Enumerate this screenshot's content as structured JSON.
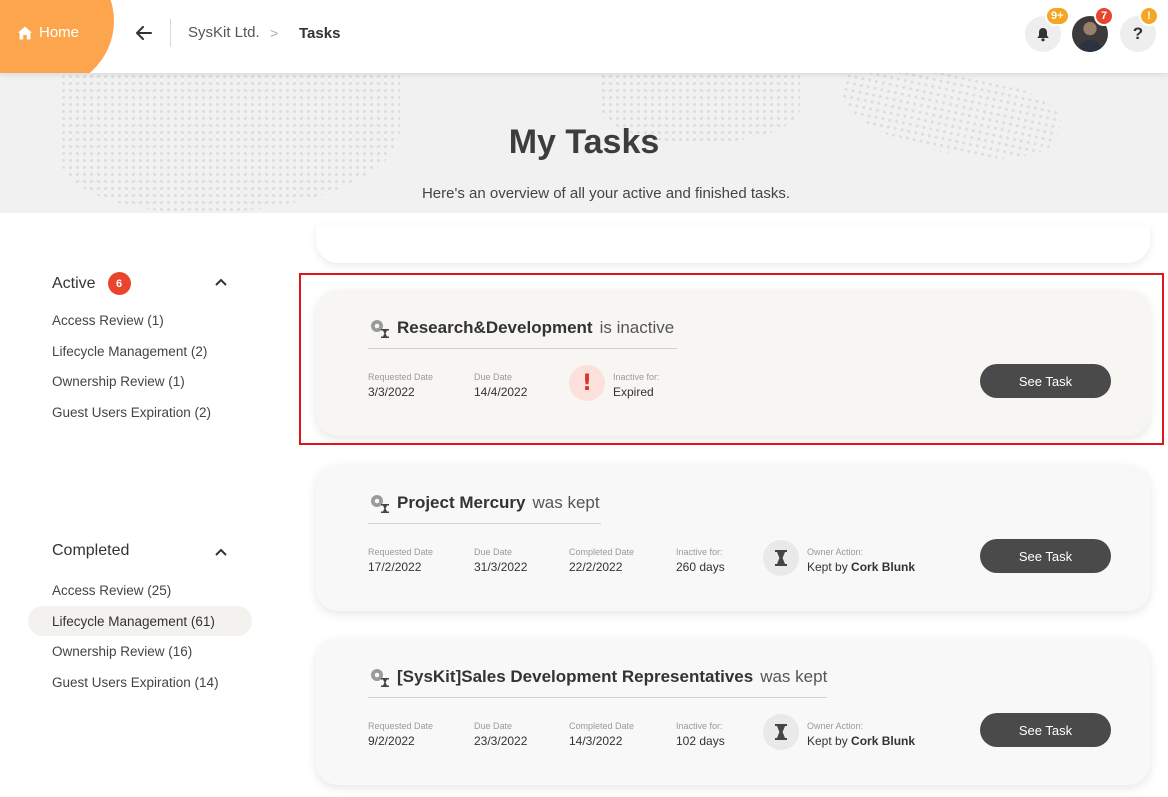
{
  "topbar": {
    "home_label": "Home",
    "breadcrumb": {
      "org": "SysKit Ltd.",
      "separator": ">",
      "current": "Tasks"
    },
    "notifications_badge": "9+",
    "profile_badge": "7",
    "help_badge": "!",
    "help_label": "?",
    "colors": {
      "accent": "#fca54d",
      "badge_orange": "#f5a623",
      "badge_red": "#e8452c"
    }
  },
  "hero": {
    "title": "My Tasks",
    "subtitle": "Here's an overview of all your active and finished tasks."
  },
  "sidebar": {
    "active": {
      "title": "Active",
      "count": "6",
      "items": [
        {
          "label": "Access Review (1)"
        },
        {
          "label": "Lifecycle Management (2)"
        },
        {
          "label": "Ownership Review (1)"
        },
        {
          "label": "Guest Users Expiration (2)"
        }
      ]
    },
    "completed": {
      "title": "Completed",
      "items": [
        {
          "label": "Access Review (25)"
        },
        {
          "label": "Lifecycle Management (61)",
          "selected": true
        },
        {
          "label": "Ownership Review (16)"
        },
        {
          "label": "Guest Users Expiration (14)"
        }
      ]
    }
  },
  "tasks": [
    {
      "name": "Research&Development",
      "verb": "is inactive",
      "requested_label": "Requested Date",
      "requested": "3/3/2022",
      "due_label": "Due Date",
      "due": "14/4/2022",
      "status_icon": "exclamation-icon",
      "inactive_label": "Inactive for:",
      "inactive": "Expired",
      "button": "See Task"
    },
    {
      "name": "Project Mercury",
      "verb": "was kept",
      "requested_label": "Requested Date",
      "requested": "17/2/2022",
      "due_label": "Due Date",
      "due": "31/3/2022",
      "completed_label": "Completed Date",
      "completed": "22/2/2022",
      "inactive_label": "Inactive for:",
      "inactive": "260 days",
      "status_icon": "hourglass-icon",
      "owner_label": "Owner Action:",
      "owner_prefix": "Kept by",
      "owner_name": "Cork Blunk",
      "button": "See Task"
    },
    {
      "name": "[SysKit]Sales Development Representatives",
      "verb": "was kept",
      "requested_label": "Requested Date",
      "requested": "9/2/2022",
      "due_label": "Due Date",
      "due": "23/3/2022",
      "completed_label": "Completed Date",
      "completed": "14/3/2022",
      "inactive_label": "Inactive for:",
      "inactive": "102 days",
      "status_icon": "hourglass-icon",
      "owner_label": "Owner Action:",
      "owner_prefix": "Kept by",
      "owner_name": "Cork Blunk",
      "button": "See Task"
    }
  ]
}
